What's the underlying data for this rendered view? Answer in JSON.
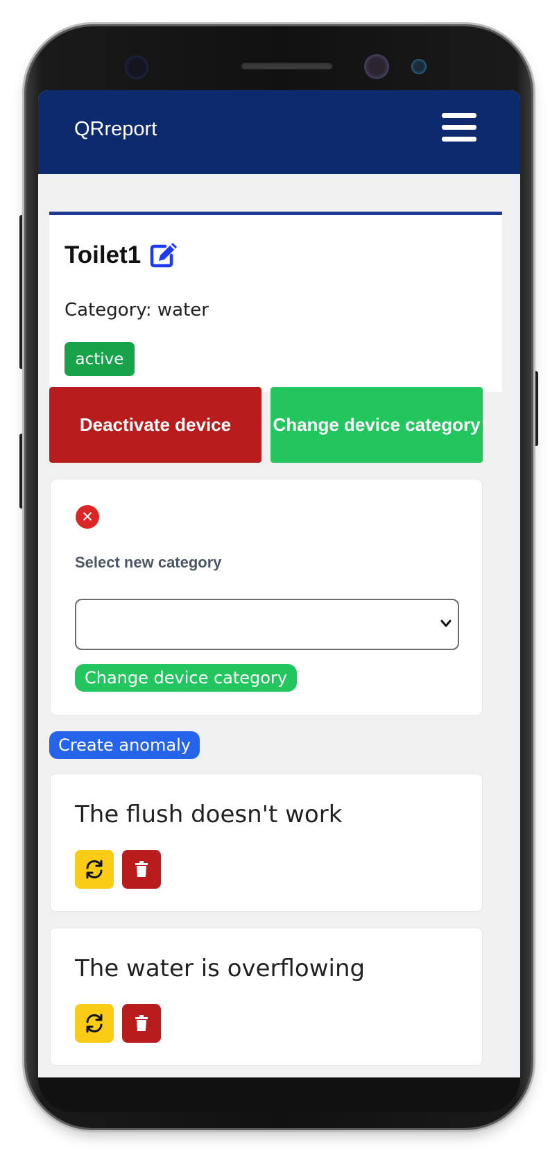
{
  "navbar": {
    "brand": "QRreport"
  },
  "device": {
    "title": "Toilet1",
    "category_line": "Category: water",
    "status": "active"
  },
  "actions": {
    "deactivate_label": "Deactivate device",
    "change_label": "Change device category"
  },
  "category_form": {
    "label": "Select new category",
    "selected_value": "",
    "submit_label": "Change device category"
  },
  "create_anomaly_label": "Create anomaly",
  "anomalies": [
    {
      "text": "The flush doesn't work"
    },
    {
      "text": "The water is overflowing"
    }
  ],
  "colors": {
    "navbar": "#0d2a6e",
    "danger": "#b91c1c",
    "success": "#22c55e",
    "primary": "#2563eb",
    "warning": "#facc15"
  }
}
